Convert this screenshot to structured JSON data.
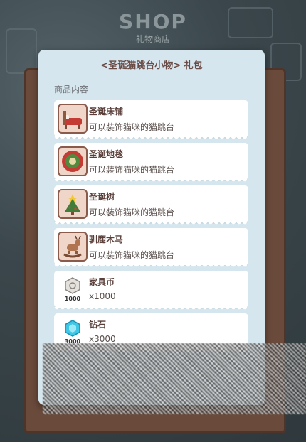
{
  "header": {
    "title": "SHOP",
    "subtitle": "礼物商店"
  },
  "dialog": {
    "title": "<圣诞猫跳台小物> 礼包",
    "section_label": "商品内容",
    "items": [
      {
        "name": "圣诞床铺",
        "desc": "可以装饰猫咪的猫跳台",
        "icon": "christmas-bed-icon"
      },
      {
        "name": "圣诞地毯",
        "desc": "可以装饰猫咪的猫跳台",
        "icon": "christmas-rug-icon"
      },
      {
        "name": "圣诞树",
        "desc": "可以装饰猫咪的猫跳台",
        "icon": "christmas-tree-icon"
      },
      {
        "name": "驯鹿木马",
        "desc": "可以装饰猫咪的猫跳台",
        "icon": "reindeer-rocking-horse-icon"
      },
      {
        "name": "家具币",
        "desc": "x1000",
        "icon": "furniture-coin-icon",
        "badge": "1000"
      },
      {
        "name": "钻石",
        "desc": "x3000",
        "icon": "diamond-icon",
        "badge": "3000"
      }
    ]
  },
  "colors": {
    "dialog_bg": "#d6e6ee",
    "title_text": "#6a4b45",
    "frame_wood": "#6a4a3b"
  }
}
